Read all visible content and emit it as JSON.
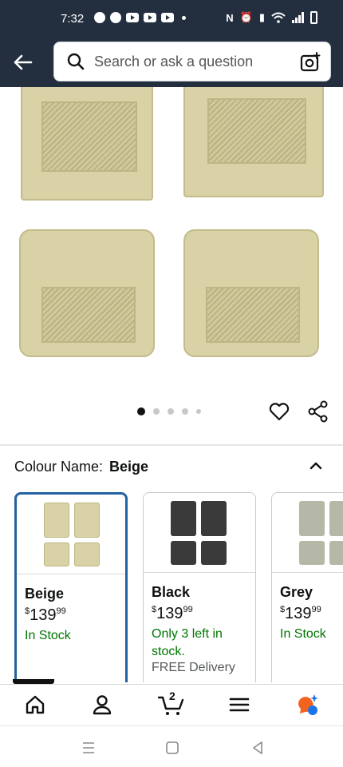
{
  "status_bar": {
    "time": "7:32"
  },
  "search": {
    "placeholder": "Search or ask a question"
  },
  "gallery": {
    "page_count": 5,
    "active_index": 0
  },
  "colour": {
    "label": "Colour Name:",
    "selected": "Beige"
  },
  "variants": [
    {
      "name": "Beige",
      "price_currency": "$",
      "price_whole": "139",
      "price_fraction": "99",
      "stock": "In Stock",
      "delivery": "",
      "color": "#d8d2a6",
      "selected": true
    },
    {
      "name": "Black",
      "price_currency": "$",
      "price_whole": "139",
      "price_fraction": "99",
      "stock": "Only 3 left in stock.",
      "delivery": "FREE Delivery",
      "color": "#3a3a3a",
      "selected": false
    },
    {
      "name": "Grey",
      "price_currency": "$",
      "price_whole": "139",
      "price_fraction": "99",
      "stock": "In Stock",
      "delivery": "",
      "color": "#b5b8a6",
      "selected": false
    }
  ],
  "bottom_nav": {
    "cart_count": "2"
  },
  "colors": {
    "header_bg": "#232f3e",
    "in_stock": "#007600",
    "selected_border": "#2162a1"
  }
}
